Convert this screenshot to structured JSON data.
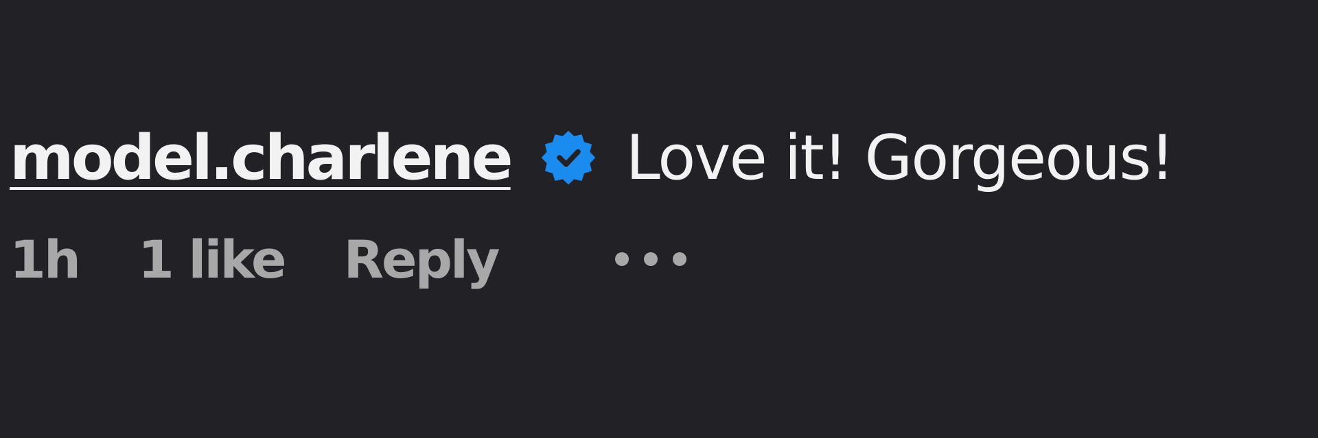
{
  "comment": {
    "username": "model.charlene",
    "text": "Love it! Gorgeous!",
    "verified_icon": "verified-badge-icon",
    "timestamp": "1h",
    "likes": "1 like",
    "reply_label": "Reply",
    "more_icon": "more-options-icon"
  },
  "colors": {
    "background": "#212126",
    "primary_text": "#f2f2f2",
    "secondary_text": "#a8a8a8",
    "verified_blue": "#1a8cf0"
  }
}
